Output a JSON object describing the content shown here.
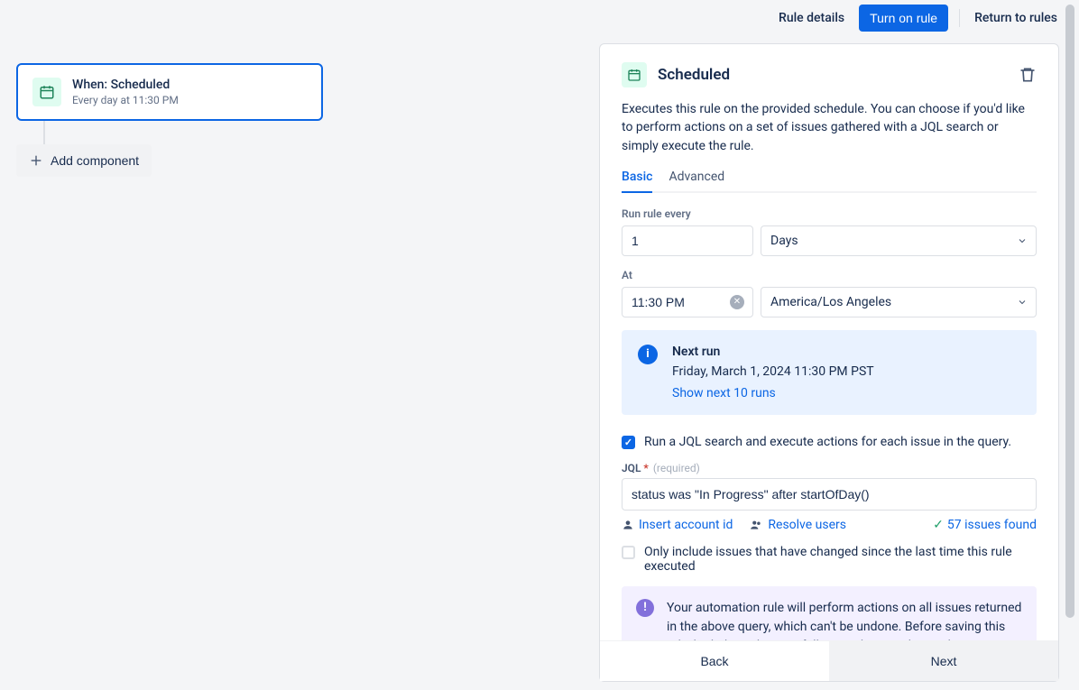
{
  "topbar": {
    "rule_details": "Rule details",
    "turn_on": "Turn on rule",
    "return": "Return to rules"
  },
  "trigger": {
    "title": "When: Scheduled",
    "subtitle": "Every day at 11:30 PM"
  },
  "add_component": "Add component",
  "panel": {
    "title": "Scheduled",
    "description": "Executes this rule on the provided schedule. You can choose if you'd like to perform actions on a set of issues gathered with a JQL search or simply execute the rule.",
    "tabs": {
      "basic": "Basic",
      "advanced": "Advanced"
    },
    "run_every_label": "Run rule every",
    "run_every_value": "1",
    "run_every_unit": "Days",
    "at_label": "At",
    "at_time": "11:30 PM",
    "timezone": "America/Los Angeles",
    "next_run": {
      "title": "Next run",
      "value": "Friday, March 1, 2024 11:30 PM PST",
      "link": "Show next 10 runs"
    },
    "jql_checkbox": "Run a JQL search and execute actions for each issue in the query.",
    "jql_label": "JQL",
    "jql_required": "(required)",
    "jql_value": "status was \"In Progress\" after startOfDay()",
    "insert_account": "Insert account id",
    "resolve_users": "Resolve users",
    "issues_found": "57 issues found",
    "only_changed": "Only include issues that have changed since the last time this rule executed",
    "warning": "Your automation rule will perform actions on all issues returned in the above query, which can't be undone. Before saving this rule, look through it carefully to make sure this is okay.",
    "back": "Back",
    "next": "Next"
  }
}
